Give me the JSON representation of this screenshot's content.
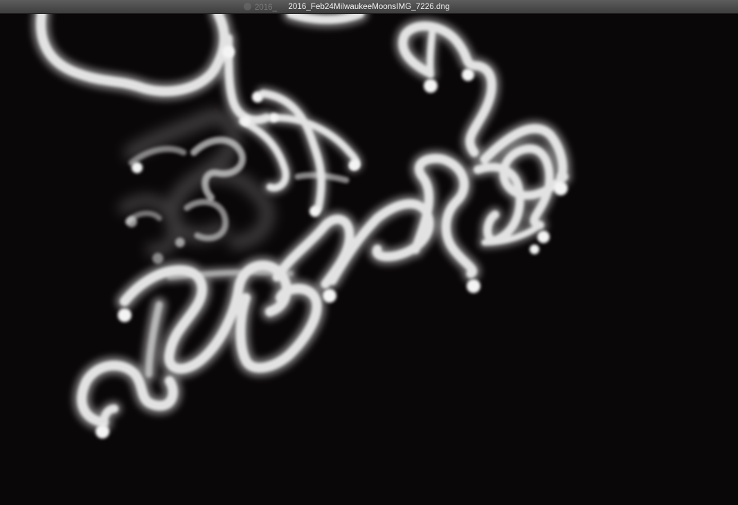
{
  "window": {
    "title": "2016_Feb24MilwaukeeMoonsIMG_7226.dng",
    "background_title": "2016_",
    "titlebar_color": "#4a4a4a"
  },
  "photo": {
    "subject": "white light-painting trails on black background",
    "trail_color": "#e9e9e9",
    "background_color": "#0a0708"
  }
}
